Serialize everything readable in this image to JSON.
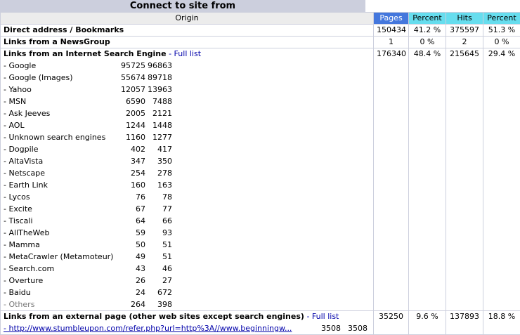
{
  "title": "Connect to site from",
  "headers": {
    "origin": "Origin",
    "pages": "Pages",
    "pages_pct": "Percent",
    "hits": "Hits",
    "hits_pct": "Percent"
  },
  "rows": {
    "direct": {
      "label": "Direct address / Bookmarks",
      "pages": "150434",
      "pages_pct": "41.2 %",
      "hits": "375597",
      "hits_pct": "51.3 %"
    },
    "newsgroup": {
      "label": "Links from a NewsGroup",
      "pages": "1",
      "pages_pct": "0 %",
      "hits": "2",
      "hits_pct": "0 %"
    },
    "search": {
      "label": "Links from an Internet Search Engine",
      "link": "- Full list",
      "pages": "176340",
      "pages_pct": "48.4 %",
      "hits": "215645",
      "hits_pct": "29.4 %"
    },
    "external": {
      "label": "Links from an external page (other web sites except search engines)",
      "link": "- Full list",
      "pages": "35250",
      "pages_pct": "9.6 %",
      "hits": "137893",
      "hits_pct": "18.8 %"
    }
  },
  "engines": [
    {
      "name": "- Google",
      "pages": "95725",
      "hits": "96863"
    },
    {
      "name": "- Google (Images)",
      "pages": "55674",
      "hits": "89718"
    },
    {
      "name": "- Yahoo",
      "pages": "12057",
      "hits": "13963"
    },
    {
      "name": "- MSN",
      "pages": "6590",
      "hits": "7488"
    },
    {
      "name": "- Ask Jeeves",
      "pages": "2005",
      "hits": "2121"
    },
    {
      "name": "- AOL",
      "pages": "1244",
      "hits": "1448"
    },
    {
      "name": "- Unknown search engines",
      "pages": "1160",
      "hits": "1277"
    },
    {
      "name": "- Dogpile",
      "pages": "402",
      "hits": "417"
    },
    {
      "name": "- AltaVista",
      "pages": "347",
      "hits": "350"
    },
    {
      "name": "- Netscape",
      "pages": "254",
      "hits": "278"
    },
    {
      "name": "- Earth Link",
      "pages": "160",
      "hits": "163"
    },
    {
      "name": "- Lycos",
      "pages": "76",
      "hits": "78"
    },
    {
      "name": "- Excite",
      "pages": "67",
      "hits": "77"
    },
    {
      "name": "- Tiscali",
      "pages": "64",
      "hits": "66"
    },
    {
      "name": "- AllTheWeb",
      "pages": "59",
      "hits": "93"
    },
    {
      "name": "- Mamma",
      "pages": "50",
      "hits": "51"
    },
    {
      "name": "- MetaCrawler (Metamoteur)",
      "pages": "49",
      "hits": "51"
    },
    {
      "name": "- Search.com",
      "pages": "43",
      "hits": "46"
    },
    {
      "name": "- Overture",
      "pages": "26",
      "hits": "27"
    },
    {
      "name": "- Baidu",
      "pages": "24",
      "hits": "672"
    },
    {
      "name": "- Others",
      "pages": "264",
      "hits": "398"
    }
  ],
  "external_first": {
    "url": "- http://www.stumbleupon.com/refer.php?url=http%3A//www.beginningw...",
    "pages": "3508",
    "hits": "3508"
  }
}
